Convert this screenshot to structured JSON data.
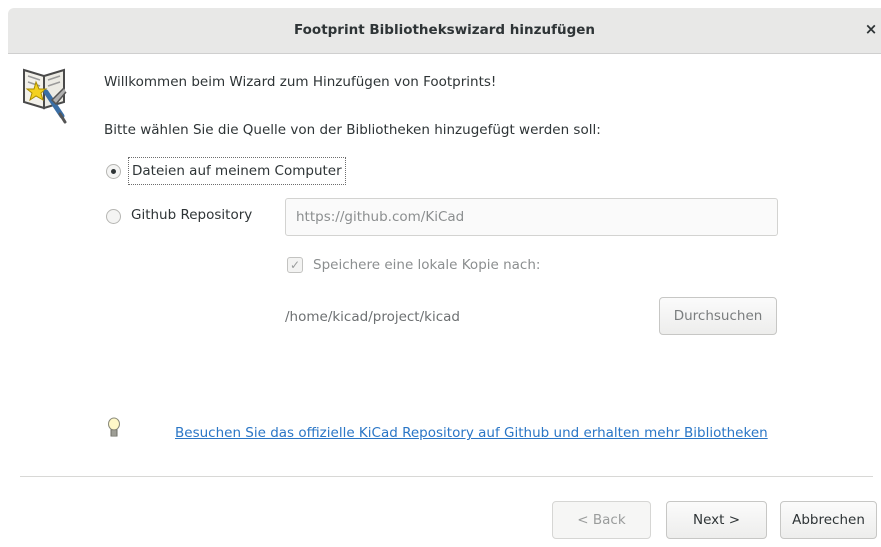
{
  "window": {
    "title": "Footprint Bibliothekswizard hinzufügen",
    "close_glyph": "×"
  },
  "intro": {
    "welcome": "Willkommen beim Wizard zum Hinzufügen von Footprints!",
    "prompt": "Bitte wählen Sie die Quelle von der Bibliotheken hinzugefügt werden soll:"
  },
  "source": {
    "selected": "local",
    "local_label": "Dateien auf meinem Computer",
    "github_label": "Github Repository",
    "github_url_placeholder": "https://github.com/KiCad"
  },
  "local_copy": {
    "checked": true,
    "label": "Speichere eine lokale Kopie nach:",
    "path": "/home/kicad/project/kicad",
    "browse_label": "Durchsuchen"
  },
  "hint": {
    "link_text": "Besuchen Sie das offizielle KiCad Repository auf Github und erhalten mehr Bibliotheken"
  },
  "buttons": {
    "back_label": "< Back",
    "next_label": "Next >",
    "cancel_label": "Abbrechen"
  },
  "icons": {
    "wizard": "wizard-book-icon",
    "hint": "lightbulb-icon",
    "check": "checkmark-icon"
  },
  "colors": {
    "link": "#2a76c6",
    "titlebar": "#e8e8e7"
  }
}
